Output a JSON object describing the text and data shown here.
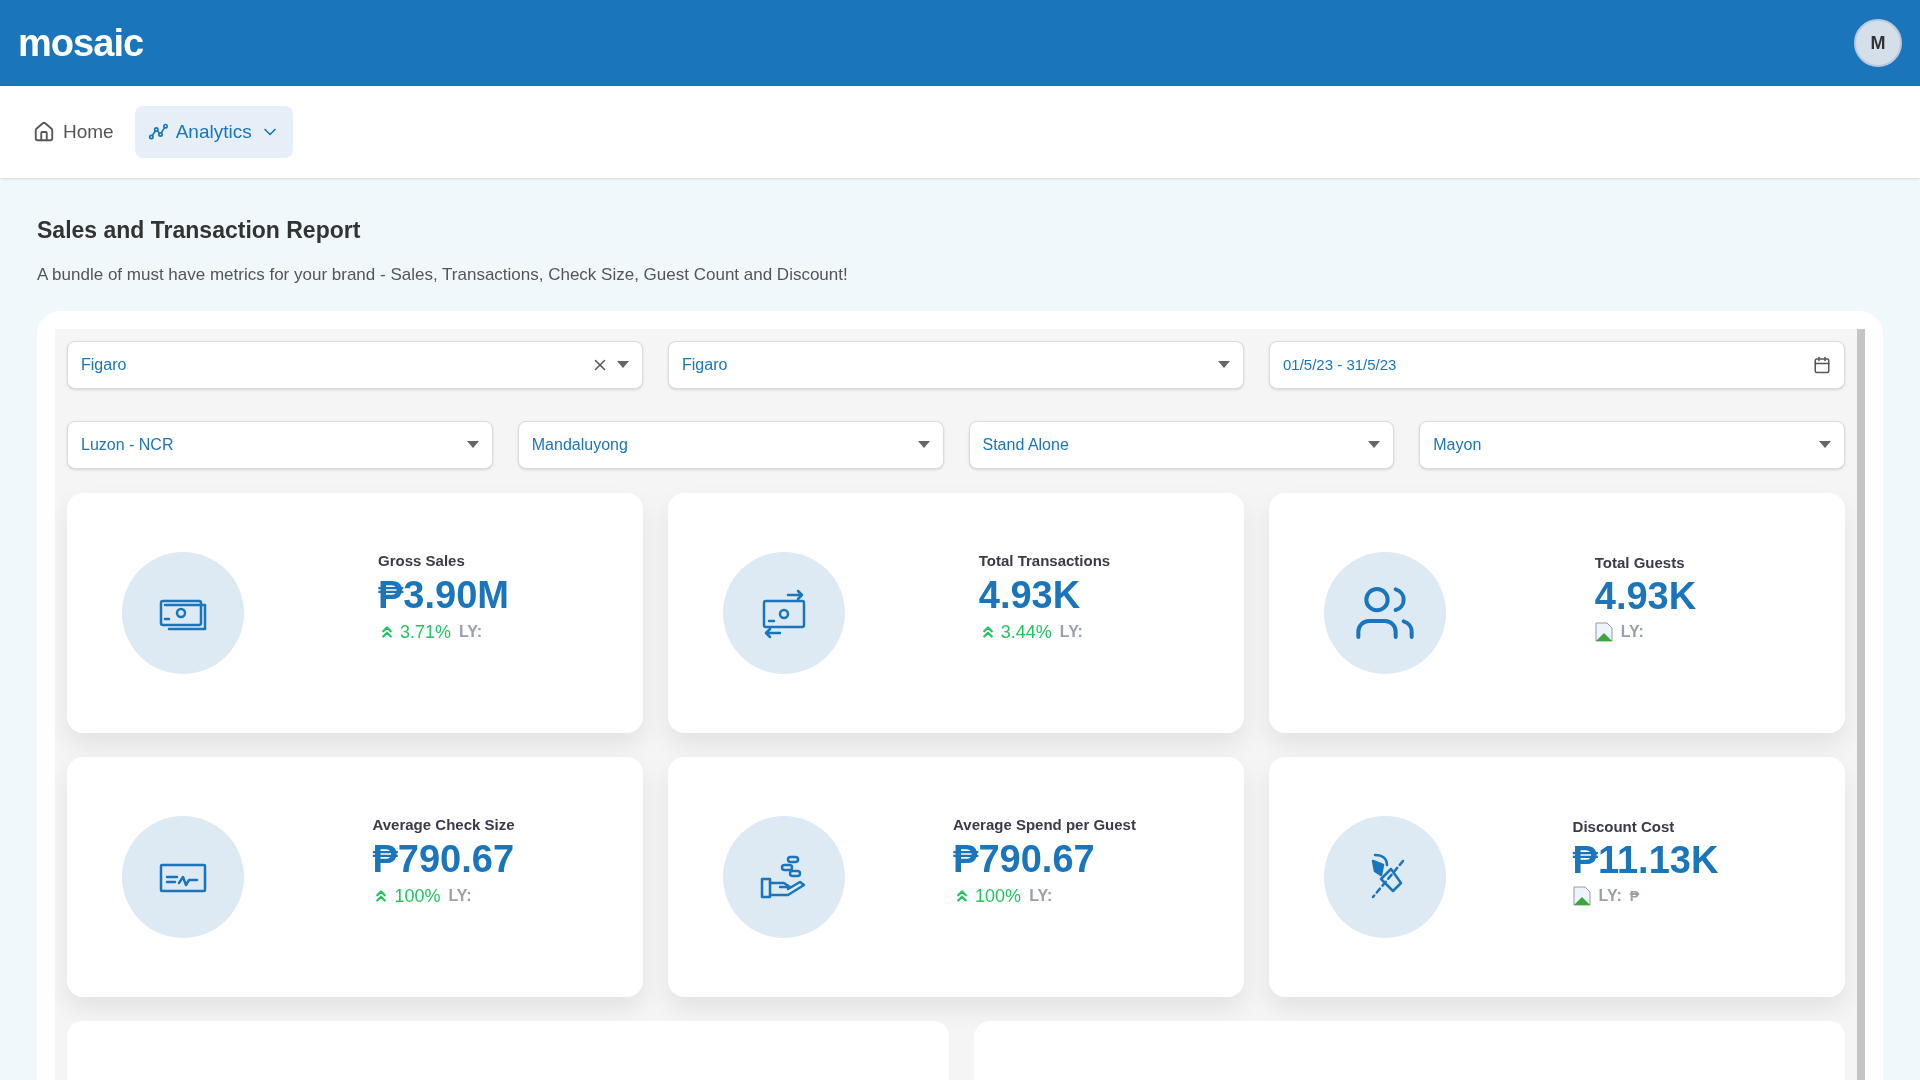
{
  "header": {
    "logo": "mosaic",
    "avatar": "M"
  },
  "nav": [
    {
      "label": "Home",
      "selected": false,
      "dropdown": false
    },
    {
      "label": "Analytics",
      "selected": true,
      "dropdown": true
    }
  ],
  "page": {
    "title": "Sales and Transaction Report",
    "subtitle": "A bundle of must have metrics for your brand - Sales, Transactions, Check Size, Guest Count and Discount!"
  },
  "filters_row_1": [
    {
      "kind": "select",
      "value": "Figaro",
      "clearable": true
    },
    {
      "kind": "select",
      "value": "Figaro",
      "clearable": false
    },
    {
      "kind": "date",
      "value": "01/5/23 - 31/5/23",
      "clearable": false
    }
  ],
  "filters_row_2": [
    {
      "kind": "select",
      "value": "Luzon - NCR",
      "clearable": false
    },
    {
      "kind": "select",
      "value": "Mandaluyong",
      "clearable": false
    },
    {
      "kind": "select",
      "value": "Stand Alone",
      "clearable": false
    },
    {
      "kind": "select",
      "value": "Mayon",
      "clearable": false
    }
  ],
  "metrics": [
    {
      "kind": "change",
      "title": "Gross Sales",
      "value": "₱3.90M",
      "change": "3.71%",
      "ly": "LY:"
    },
    {
      "kind": "change",
      "title": "Total Transactions",
      "value": "4.93K",
      "change": "3.44%",
      "ly": "LY:"
    },
    {
      "kind": "missing-image",
      "title": "Total Guests",
      "value": "4.93K",
      "ly": "LY:"
    },
    {
      "kind": "change",
      "title": "Average Check Size",
      "value": "₱790.67",
      "change": "100%",
      "ly": "LY:"
    },
    {
      "kind": "change",
      "title": "Average Spend per Guest",
      "value": "₱790.67",
      "change": "100%",
      "ly": "LY:"
    },
    {
      "kind": "missing-image",
      "title": "Discount Cost",
      "value": "₱11.13K",
      "ly": "LY:",
      "ly_value": "₱"
    }
  ]
}
